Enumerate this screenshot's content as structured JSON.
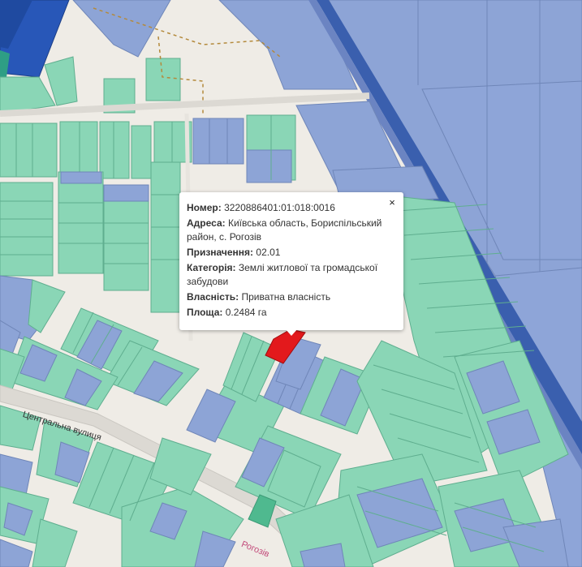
{
  "map": {
    "street_labels": [
      "Центральна вулиця",
      "Рогозів"
    ]
  },
  "popup": {
    "close_symbol": "×",
    "fields": [
      {
        "key": "Номер:",
        "value": "3220886401:01:018:0016"
      },
      {
        "key": "Адреса:",
        "value": "Київська область, Бориспільський район, с. Рогозів"
      },
      {
        "key": "Призначення:",
        "value": "02.01"
      },
      {
        "key": "Категорія:",
        "value": "Землі житлової та громадської забудови"
      },
      {
        "key": "Власність:",
        "value": "Приватна власність"
      },
      {
        "key": "Площа:",
        "value": "0.2484 га"
      }
    ]
  },
  "colors": {
    "background": "#efece6",
    "private_parcel": "#8ad6b6",
    "state_parcel": "#8da4d6",
    "dark_state_parcel": "#2857b8",
    "highlight_parcel": "#e3191c",
    "railway": "#3a5fae"
  }
}
